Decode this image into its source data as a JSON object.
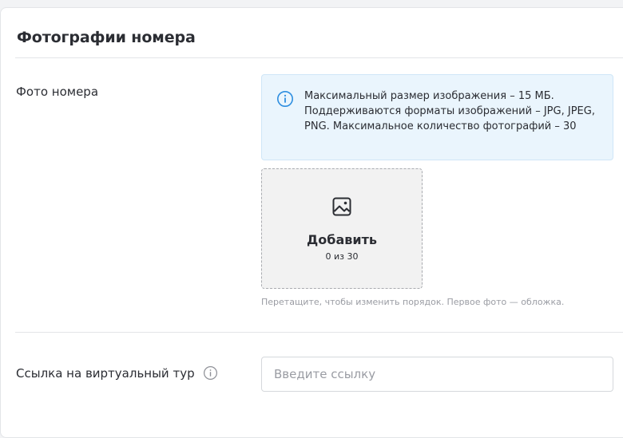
{
  "section": {
    "title": "Фотографии номера"
  },
  "photos": {
    "label": "Фото номера",
    "info_icon": "info-circle-icon",
    "info_text": "Максимальный размер изображения – 15 МБ. Поддерживаются форматы изображений – JPG, JPEG, PNG. Максимальное количество фотографий – 30",
    "upload": {
      "icon": "image-icon",
      "label": "Добавить",
      "count": "0 из 30"
    },
    "hint": "Перетащите, чтобы изменить порядок. Первое фото — обложка."
  },
  "tour": {
    "label": "Ссылка на виртуальный тур",
    "help_icon": "info-circle-icon",
    "input_value": "",
    "input_placeholder": "Введите ссылку"
  },
  "colors": {
    "info_background": "#eaf5fd",
    "info_icon": "#2e8ee0",
    "upload_background": "#f2f2f2",
    "muted_text": "#9a9ca3"
  }
}
